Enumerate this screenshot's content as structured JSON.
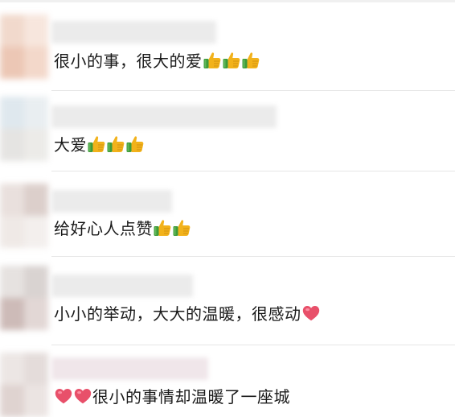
{
  "comments": [
    {
      "text": "很小的事，很大的爱",
      "emoji": "thumbs-up",
      "emoji_count": 3,
      "emoji_position": "after"
    },
    {
      "text": "大爱",
      "emoji": "thumbs-up",
      "emoji_count": 3,
      "emoji_position": "after"
    },
    {
      "text": "给好心人点赞",
      "emoji": "thumbs-up",
      "emoji_count": 2,
      "emoji_position": "after"
    },
    {
      "text": "小小的举动，大大的温暖，很感动",
      "emoji": "heart",
      "emoji_count": 1,
      "emoji_position": "after"
    },
    {
      "text": "很小的事情却温暖了一座城",
      "emoji": "heart",
      "emoji_count": 2,
      "emoji_position": "before"
    }
  ],
  "colors": {
    "text": "#1a1a1a",
    "divider": "#e6e6e6",
    "name_placeholder": "#ebebeb",
    "thumb_hand": "#f2b21b",
    "thumb_cuff": "#3e9b3a",
    "heart": "#e8506a"
  }
}
